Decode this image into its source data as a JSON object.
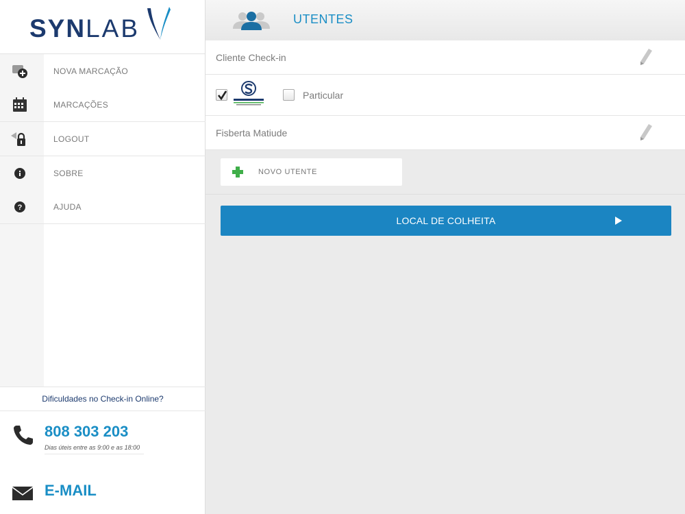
{
  "logo": {
    "bold": "SYN",
    "light": "LAB"
  },
  "sidebar": {
    "groups": [
      {
        "items": [
          {
            "label": "NOVA MARCAÇÃO",
            "icon": "calendar-plus-icon"
          },
          {
            "label": "MARCAÇÕES",
            "icon": "calendar-icon"
          }
        ]
      },
      {
        "items": [
          {
            "label": "LOGOUT",
            "icon": "lock-icon"
          }
        ]
      },
      {
        "items": [
          {
            "label": "SOBRE",
            "icon": "info-icon"
          },
          {
            "label": "AJUDA",
            "icon": "help-icon"
          }
        ]
      }
    ],
    "help": "Dificuldades no Check-in Online?",
    "phone": {
      "number": "808 303 203",
      "hours": "Dias úteis entre as 9:00 e as 18:00"
    },
    "email": "E-MAIL"
  },
  "header": {
    "title": "UTENTES",
    "icon": "users-icon"
  },
  "main": {
    "client_label": "Cliente Check-in",
    "insurance": {
      "services_checked": true,
      "particular_label": "Particular",
      "particular_checked": false
    },
    "patient_name": "Fisberta Matiude",
    "novo_utente": "NOVO UTENTE",
    "local_button": "LOCAL DE COLHEITA"
  },
  "colors": {
    "accent": "#1a8ec5",
    "button": "#1b85c2",
    "brand": "#1c3a6e",
    "plus": "#3fae49"
  }
}
